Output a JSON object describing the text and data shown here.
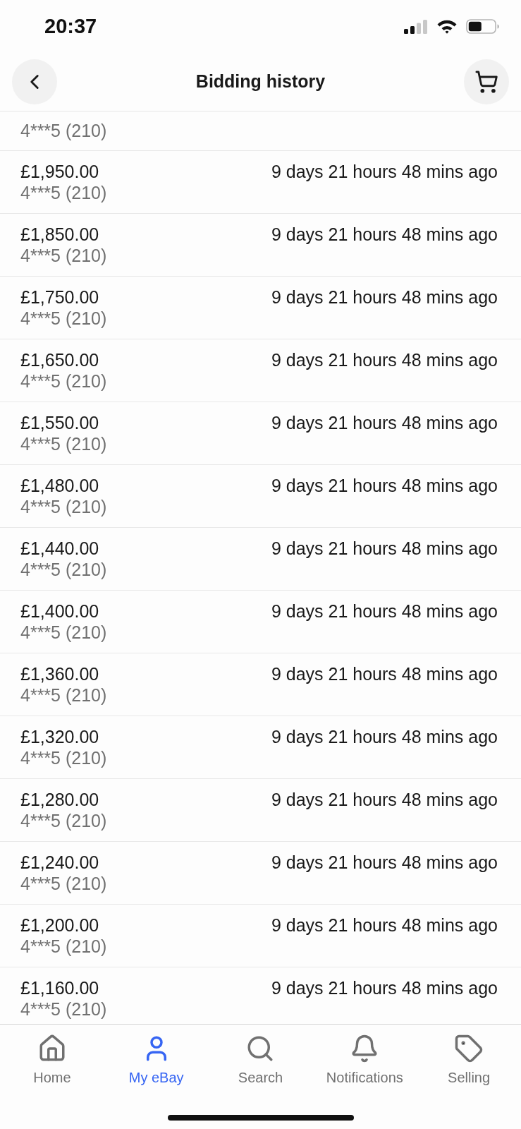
{
  "status_bar": {
    "time": "20:37"
  },
  "header": {
    "title": "Bidding history"
  },
  "bids": [
    {
      "kind": "partial",
      "bidder": "4***5 (210)"
    },
    {
      "kind": "full",
      "amount": "£1,950.00",
      "bidder": "4***5 (210)",
      "time": "9 days 21 hours 48 mins ago"
    },
    {
      "kind": "full",
      "amount": "£1,850.00",
      "bidder": "4***5 (210)",
      "time": "9 days 21 hours 48 mins ago"
    },
    {
      "kind": "full",
      "amount": "£1,750.00",
      "bidder": "4***5 (210)",
      "time": "9 days 21 hours 48 mins ago"
    },
    {
      "kind": "full",
      "amount": "£1,650.00",
      "bidder": "4***5 (210)",
      "time": "9 days 21 hours 48 mins ago"
    },
    {
      "kind": "full",
      "amount": "£1,550.00",
      "bidder": "4***5 (210)",
      "time": "9 days 21 hours 48 mins ago"
    },
    {
      "kind": "full",
      "amount": "£1,480.00",
      "bidder": "4***5 (210)",
      "time": "9 days 21 hours 48 mins ago"
    },
    {
      "kind": "full",
      "amount": "£1,440.00",
      "bidder": "4***5 (210)",
      "time": "9 days 21 hours 48 mins ago"
    },
    {
      "kind": "full",
      "amount": "£1,400.00",
      "bidder": "4***5 (210)",
      "time": "9 days 21 hours 48 mins ago"
    },
    {
      "kind": "full",
      "amount": "£1,360.00",
      "bidder": "4***5 (210)",
      "time": "9 days 21 hours 48 mins ago"
    },
    {
      "kind": "full",
      "amount": "£1,320.00",
      "bidder": "4***5 (210)",
      "time": "9 days 21 hours 48 mins ago"
    },
    {
      "kind": "full",
      "amount": "£1,280.00",
      "bidder": "4***5 (210)",
      "time": "9 days 21 hours 48 mins ago"
    },
    {
      "kind": "full",
      "amount": "£1,240.00",
      "bidder": "4***5 (210)",
      "time": "9 days 21 hours 48 mins ago"
    },
    {
      "kind": "full",
      "amount": "£1,200.00",
      "bidder": "4***5 (210)",
      "time": "9 days 21 hours 48 mins ago"
    },
    {
      "kind": "full",
      "amount": "£1,160.00",
      "bidder": "4***5 (210)",
      "time": "9 days 21 hours 48 mins ago"
    }
  ],
  "tab_bar": [
    {
      "label": "Home",
      "selected": false
    },
    {
      "label": "My eBay",
      "selected": true
    },
    {
      "label": "Search",
      "selected": false
    },
    {
      "label": "Notifications",
      "selected": false
    },
    {
      "label": "Selling",
      "selected": false
    }
  ]
}
